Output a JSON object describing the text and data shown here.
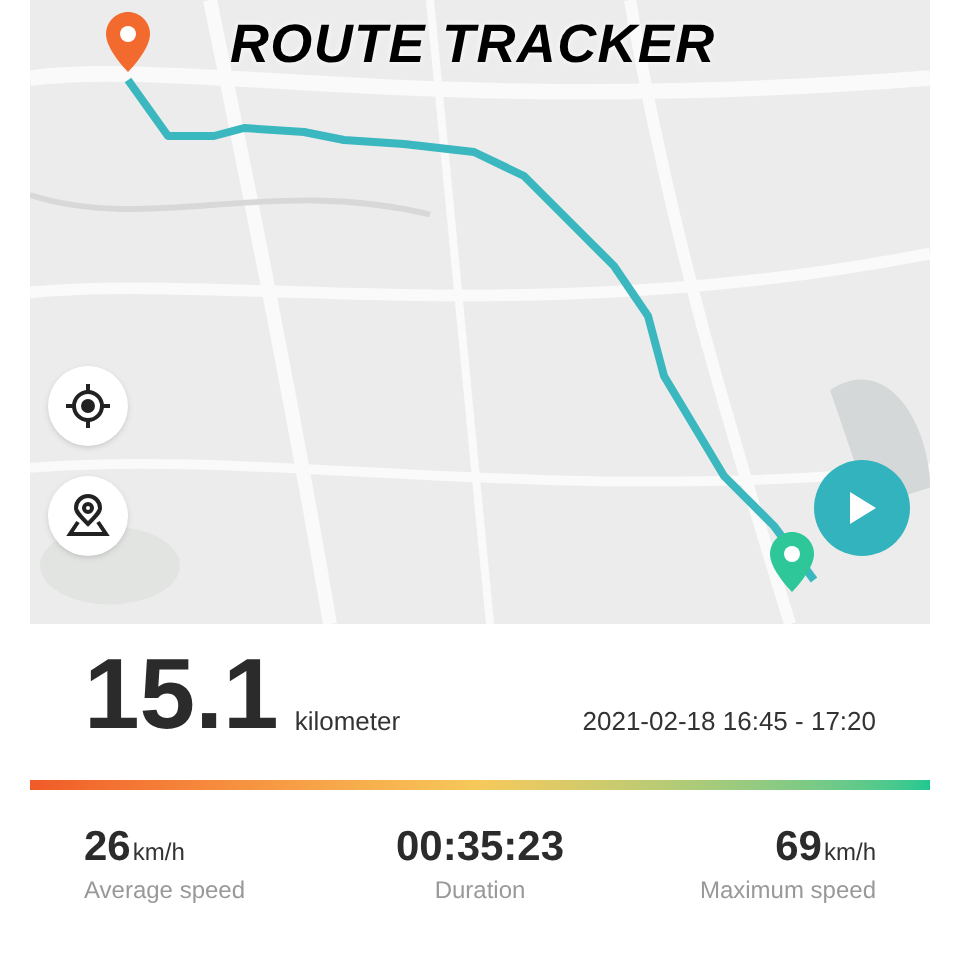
{
  "map": {
    "kind": "picture",
    "title": "ROUTE TRACKER"
  },
  "trip": {
    "distance": "15.1",
    "unit": "kilometer",
    "time_range": "2021-02-18 16:45 - 17:20"
  },
  "stats": [
    {
      "value": "26",
      "unit": "km/h",
      "label": "Average speed"
    },
    {
      "value": "00:35:23",
      "label": "Duration"
    },
    {
      "value": "69",
      "unit": "km/h",
      "label": "Maximum speed"
    }
  ]
}
